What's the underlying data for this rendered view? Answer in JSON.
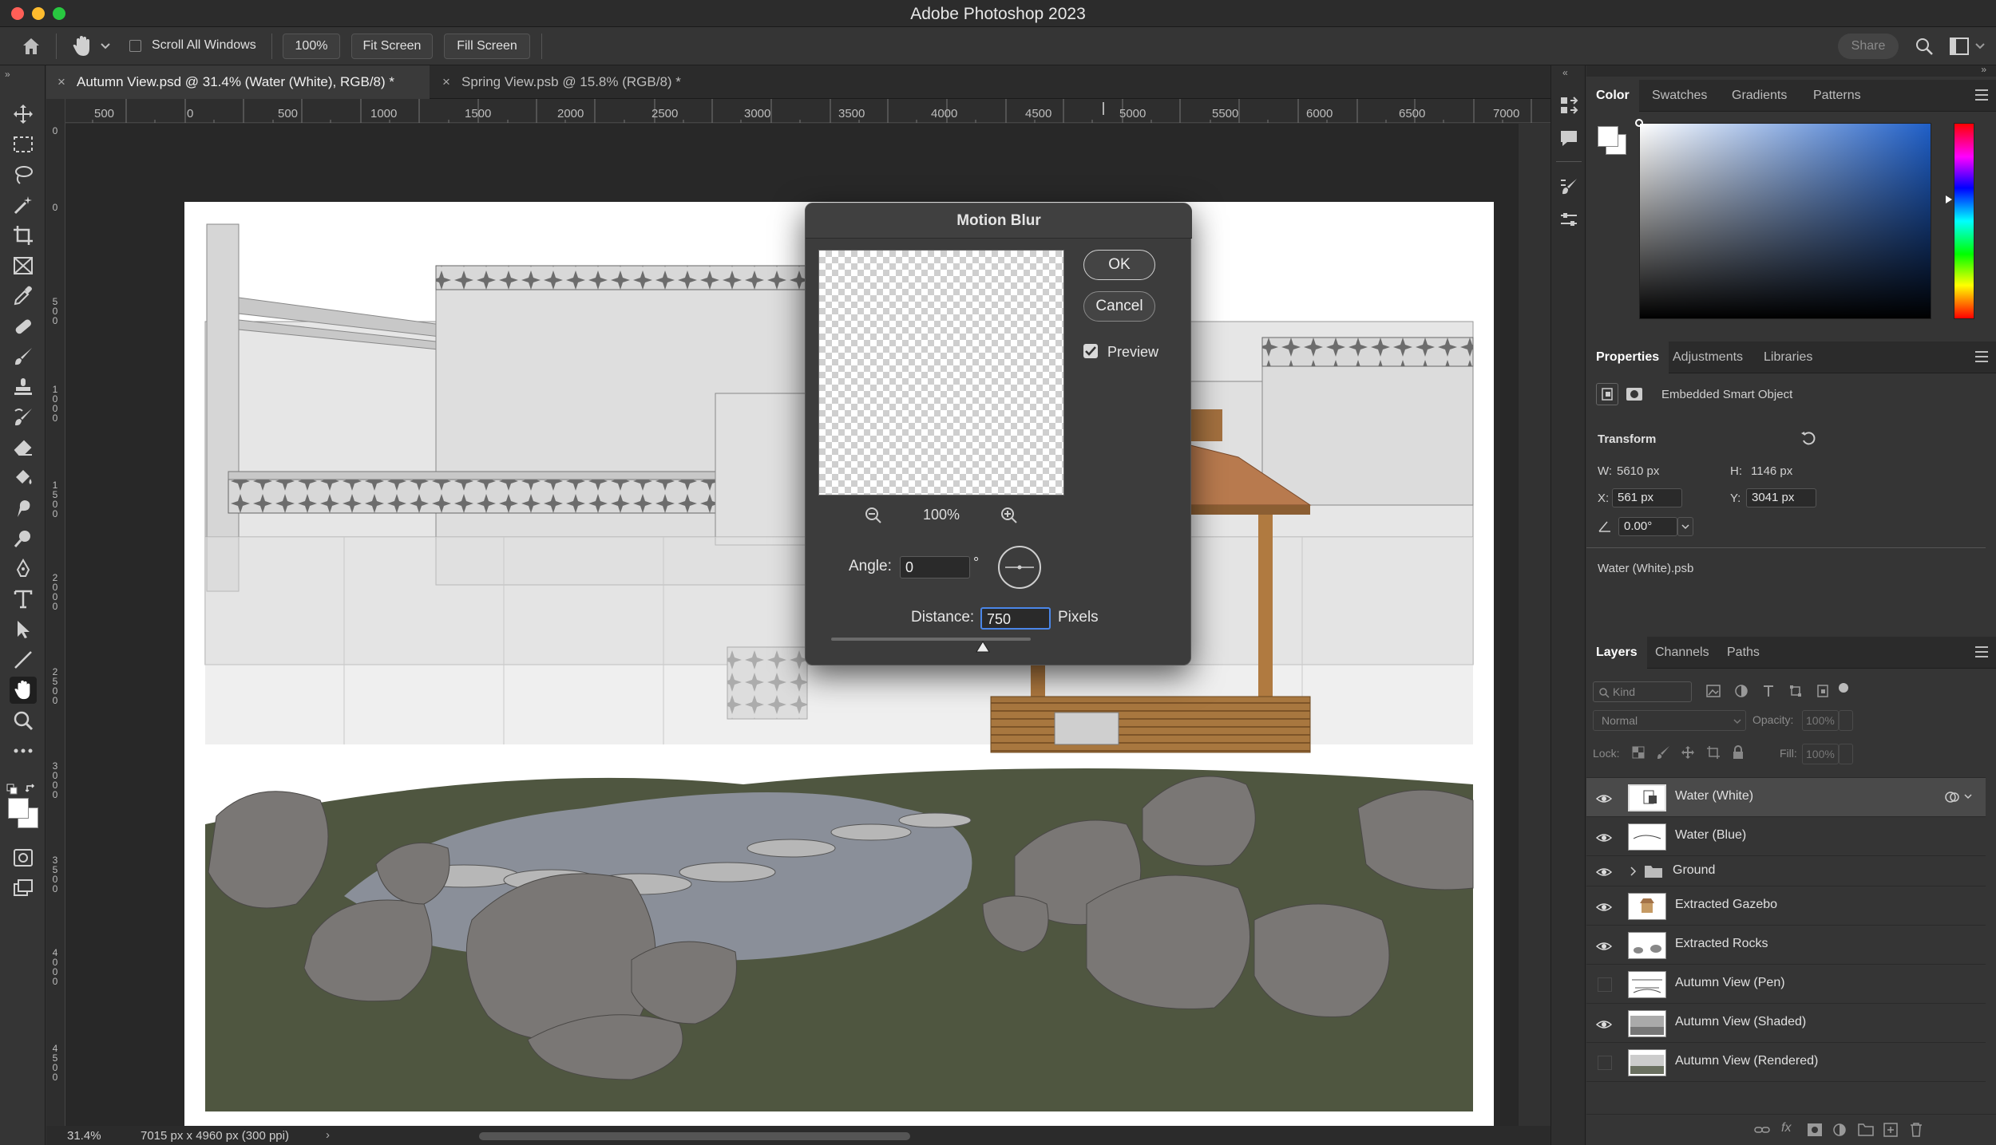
{
  "app": {
    "title": "Adobe Photoshop 2023"
  },
  "options_bar": {
    "scroll_all_windows": "Scroll All Windows",
    "zoom_value": "100%",
    "fit_screen": "Fit Screen",
    "fill_screen": "Fill Screen",
    "share": "Share"
  },
  "tabs": [
    {
      "label": "Autumn View.psd @ 31.4% (Water (White), RGB/8) *",
      "active": true
    },
    {
      "label": "Spring View.psb @ 15.8% (RGB/8) *",
      "active": false
    }
  ],
  "ruler": {
    "h_labels": [
      "500",
      "0",
      "500",
      "1000",
      "1500",
      "2000",
      "2500",
      "3000",
      "3500",
      "4000",
      "4500",
      "5000",
      "5500",
      "6000",
      "6500",
      "7000"
    ],
    "v_labels": [
      "0",
      "0",
      "500",
      "1000",
      "1500",
      "2000",
      "2500",
      "3000",
      "3500",
      "4000",
      "4500"
    ]
  },
  "status": {
    "zoom": "31.4%",
    "doc_size": "7015 px x 4960 px (300 ppi)"
  },
  "dialog": {
    "title": "Motion Blur",
    "ok": "OK",
    "cancel": "Cancel",
    "preview_label": "Preview",
    "preview_checked": true,
    "zoom": "100%",
    "angle_label": "Angle:",
    "angle_value": "0",
    "degree": "°",
    "distance_label": "Distance:",
    "distance_value": "750",
    "distance_unit": "Pixels",
    "distance_slider_fraction": 0.76
  },
  "color_panel": {
    "tabs": [
      "Color",
      "Swatches",
      "Gradients",
      "Patterns"
    ],
    "hue_color": "#1f5fc8"
  },
  "properties_panel": {
    "tabs": [
      "Properties",
      "Adjustments",
      "Libraries"
    ],
    "object_type": "Embedded Smart Object",
    "transform_label": "Transform",
    "w_label": "W:",
    "w_value": "5610 px",
    "h_label": "H:",
    "h_value": "1146 px",
    "x_label": "X:",
    "x_value": "561 px",
    "y_label": "Y:",
    "y_value": "3041 px",
    "angle_value": "0.00°",
    "linked_file": "Water (White).psb"
  },
  "layers_panel": {
    "tabs": [
      "Layers",
      "Channels",
      "Paths"
    ],
    "kind_placeholder": "Kind",
    "blend_mode": "Normal",
    "opacity_label": "Opacity:",
    "opacity_value": "100%",
    "lock_label": "Lock:",
    "fill_label": "Fill:",
    "fill_value": "100%",
    "layers": [
      {
        "name": "Water (White)",
        "visible": true,
        "selected": true,
        "type": "smart"
      },
      {
        "name": "Water (Blue)",
        "visible": true,
        "selected": false,
        "type": "smart"
      },
      {
        "name": "Ground",
        "visible": true,
        "selected": false,
        "type": "group"
      },
      {
        "name": "Extracted Gazebo",
        "visible": true,
        "selected": false,
        "type": "smart"
      },
      {
        "name": "Extracted Rocks",
        "visible": true,
        "selected": false,
        "type": "smart"
      },
      {
        "name": "Autumn View (Pen)",
        "visible": false,
        "selected": false,
        "type": "image"
      },
      {
        "name": "Autumn View (Shaded)",
        "visible": true,
        "selected": false,
        "type": "image"
      },
      {
        "name": "Autumn View (Rendered)",
        "visible": false,
        "selected": false,
        "type": "image"
      }
    ]
  }
}
